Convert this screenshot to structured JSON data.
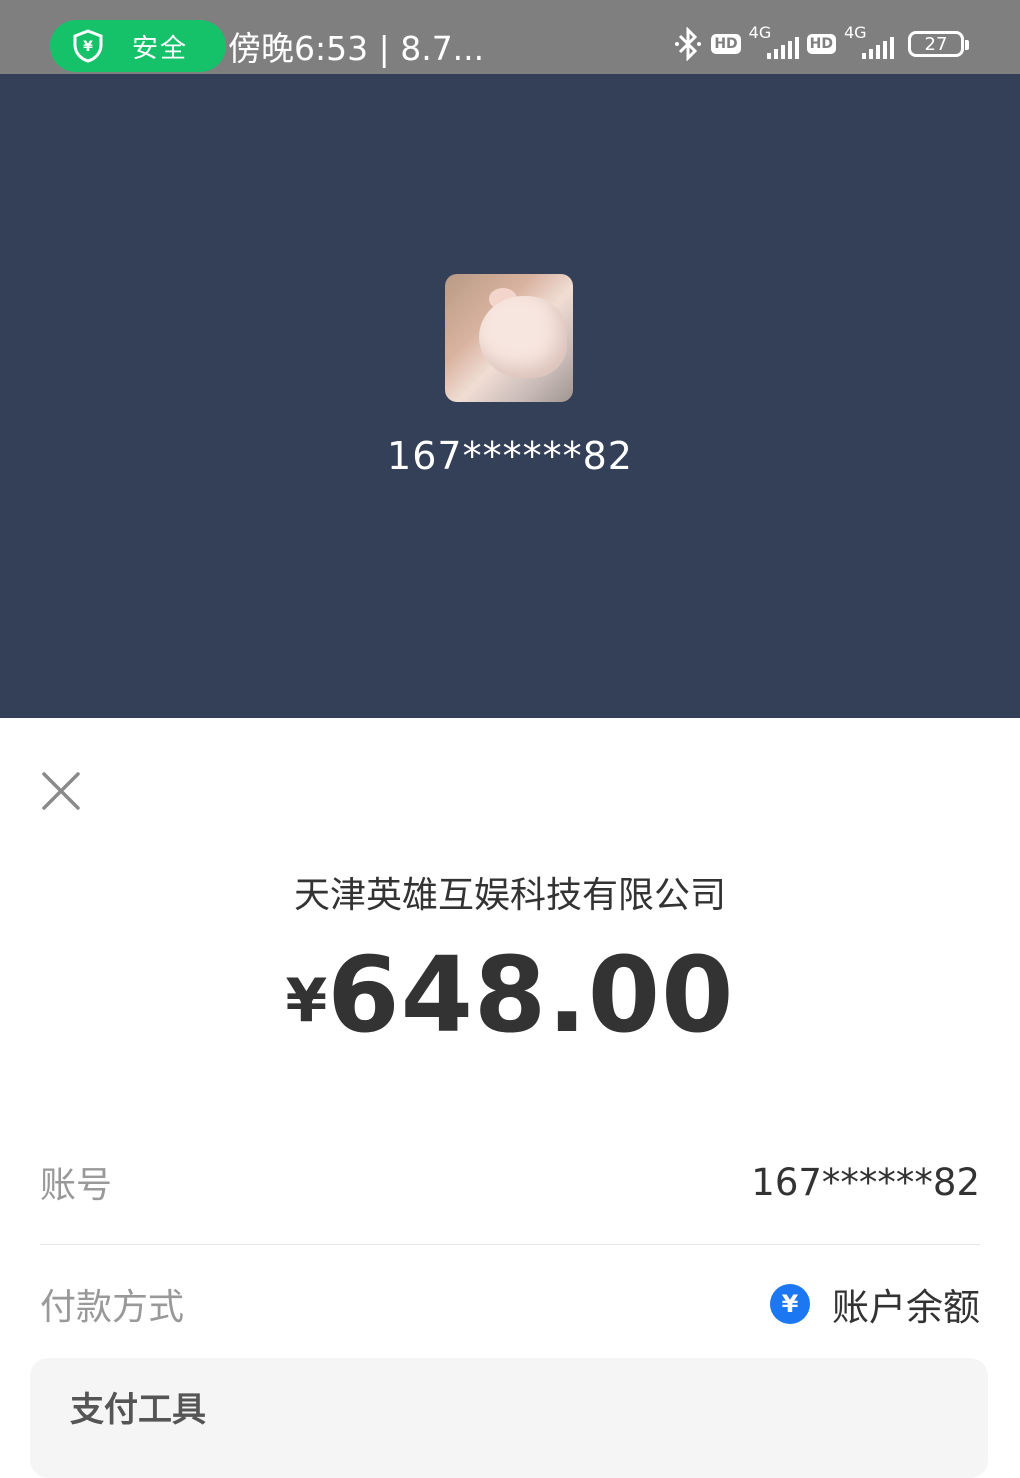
{
  "status_bar": {
    "safety_label": "安全",
    "time_text": "傍晚6:53 | 8.7...",
    "hd1": "HD",
    "net1": "4G",
    "hd2": "HD",
    "net2": "4G",
    "battery": "27"
  },
  "header": {
    "account_masked": "167******82"
  },
  "sheet": {
    "merchant": "天津英雄互娱科技有限公司",
    "currency": "¥",
    "amount": "648.00",
    "account_label": "账号",
    "account_value": "167******82",
    "pay_method_label": "付款方式",
    "pay_method_icon": "¥",
    "pay_method_value": "账户余额",
    "tool_title": "支付工具"
  },
  "colors": {
    "header_bg": "#344057",
    "status_bg": "#7f7f7f",
    "safe_green": "#15c26a",
    "accent_blue": "#1b78f2"
  }
}
